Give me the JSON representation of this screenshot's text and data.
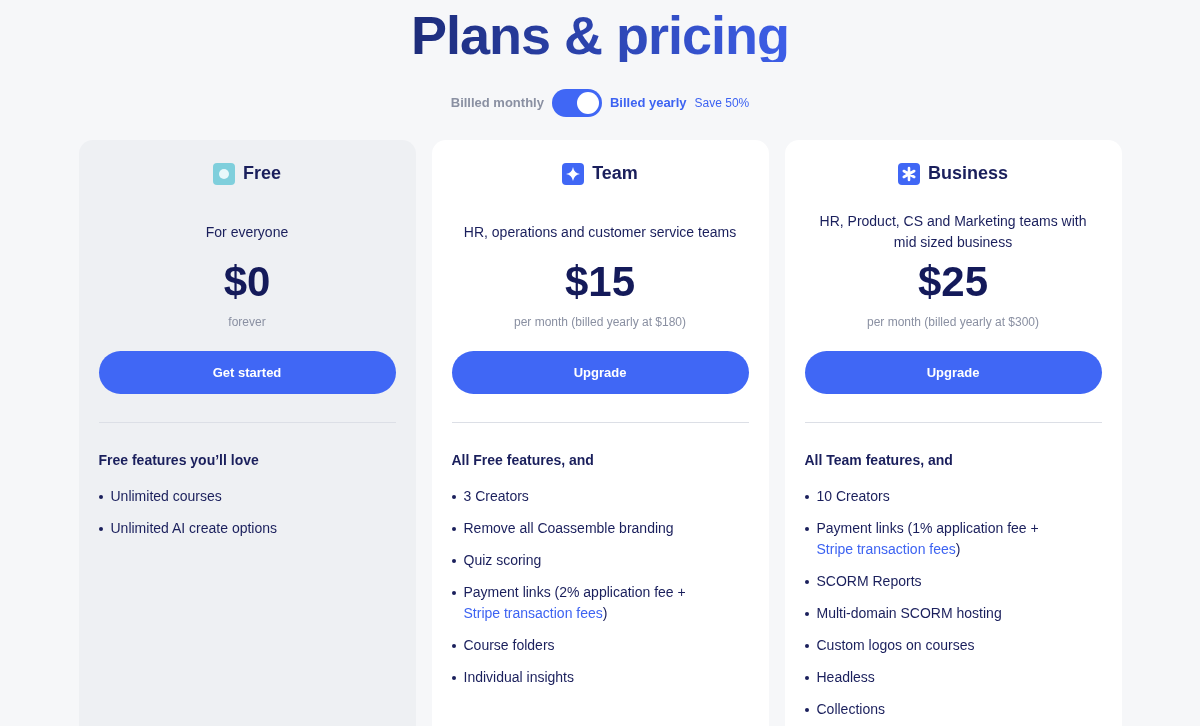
{
  "title": "Plans & pricing",
  "billing": {
    "left_label": "Billled monthly",
    "on": true,
    "right_label": "Billed yearly",
    "note": "Save 50%"
  },
  "plans": [
    {
      "name": "Free",
      "highlighted": true,
      "description": "For everyone",
      "price": "$0",
      "period": "forever",
      "button": "Get started",
      "features_heading": "Free features you’ll love",
      "features": [
        {
          "text": "Unlimited courses"
        },
        {
          "text": "Unlimited AI create options"
        }
      ]
    },
    {
      "name": "Team",
      "highlighted": false,
      "description": "HR, operations and customer service teams",
      "price": "$15",
      "period": "per month (billed yearly at $180)",
      "button": "Upgrade",
      "features_heading": "All Free features, and",
      "features": [
        {
          "text": "3 Creators"
        },
        {
          "text": "Remove all Coassemble branding"
        },
        {
          "text": "Quiz scoring"
        },
        {
          "text": "Payment links (2% application fee + ",
          "link": "Stripe transaction fees",
          "after": ")"
        },
        {
          "text": "Course folders"
        },
        {
          "text": "Individual insights"
        }
      ]
    },
    {
      "name": "Business",
      "highlighted": false,
      "description": "HR, Product, CS and Marketing teams with mid sized business",
      "price": "$25",
      "period": "per month (billed yearly at $300)",
      "button": "Upgrade",
      "features_heading": "All Team features, and",
      "features": [
        {
          "text": "10 Creators"
        },
        {
          "text": "Payment links (1% application fee + ",
          "link": "Stripe transaction fees",
          "after": ")"
        },
        {
          "text": "SCORM Reports"
        },
        {
          "text": "Multi-domain SCORM hosting"
        },
        {
          "text": "Custom logos on courses"
        },
        {
          "text": "Headless"
        },
        {
          "text": "Collections"
        }
      ]
    }
  ]
}
